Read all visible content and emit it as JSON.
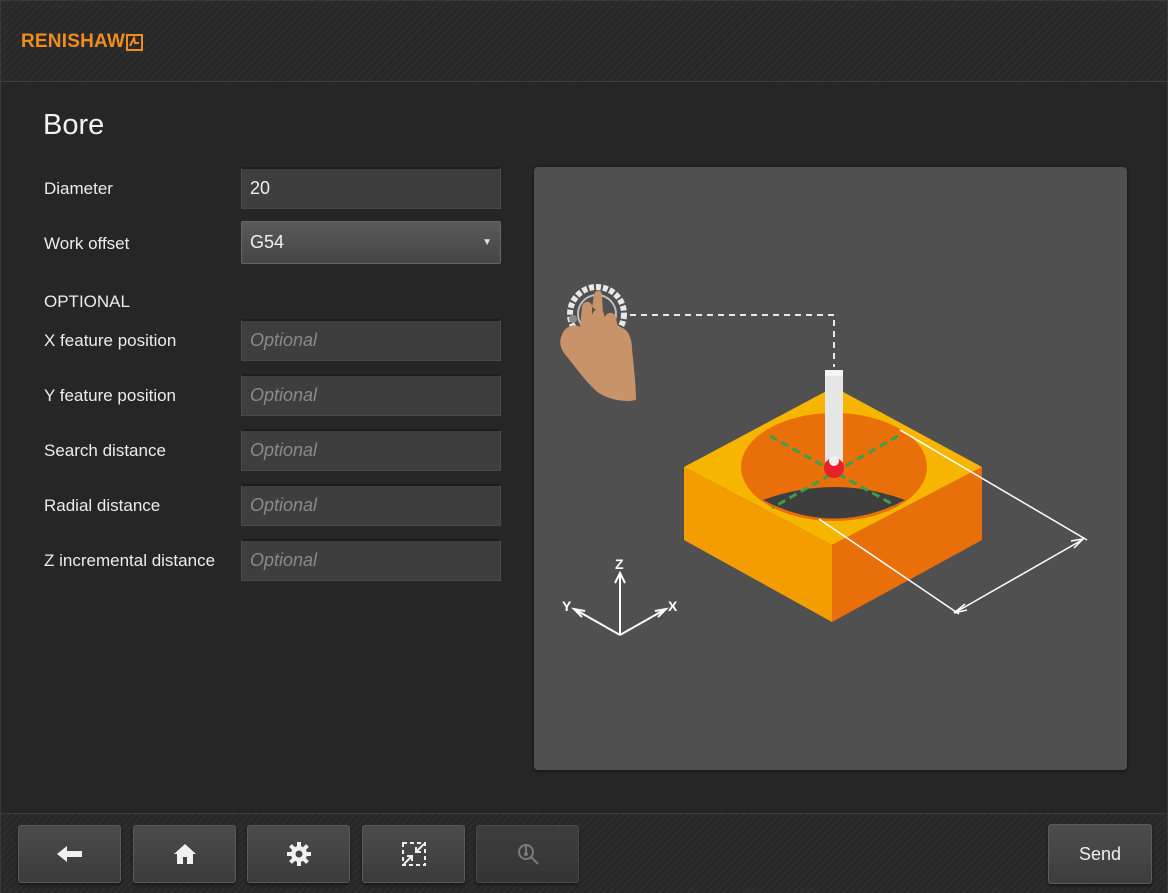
{
  "header": {
    "brand": "RENISHAW"
  },
  "page": {
    "title": "Bore"
  },
  "form": {
    "diameter": {
      "label": "Diameter",
      "value": "20"
    },
    "work_offset": {
      "label": "Work offset",
      "value": "G54"
    },
    "optional_heading": "OPTIONAL",
    "x_feature_position": {
      "label": "X feature position",
      "placeholder": "Optional"
    },
    "y_feature_position": {
      "label": "Y feature position",
      "placeholder": "Optional"
    },
    "search_distance": {
      "label": "Search distance",
      "placeholder": "Optional"
    },
    "radial_distance": {
      "label": "Radial distance",
      "placeholder": "Optional"
    },
    "z_incremental_distance": {
      "label": "Z incremental distance",
      "placeholder": "Optional"
    }
  },
  "illustration": {
    "axis_labels": {
      "z": "Z",
      "y": "Y",
      "x": "X"
    }
  },
  "footer": {
    "back_icon": "arrow-left-icon",
    "home_icon": "home-icon",
    "settings_icon": "gear-icon",
    "set_position_icon": "compress-arrows-icon",
    "inspect_icon": "magnifier-probe-icon",
    "send_label": "Send"
  },
  "colors": {
    "brand": "#f28c1e",
    "block_top": "#f7b500",
    "block_front": "#f49d00",
    "block_side": "#e86f0a",
    "probe_tip": "#e8202a",
    "measure_lines": "#3aa04a"
  }
}
